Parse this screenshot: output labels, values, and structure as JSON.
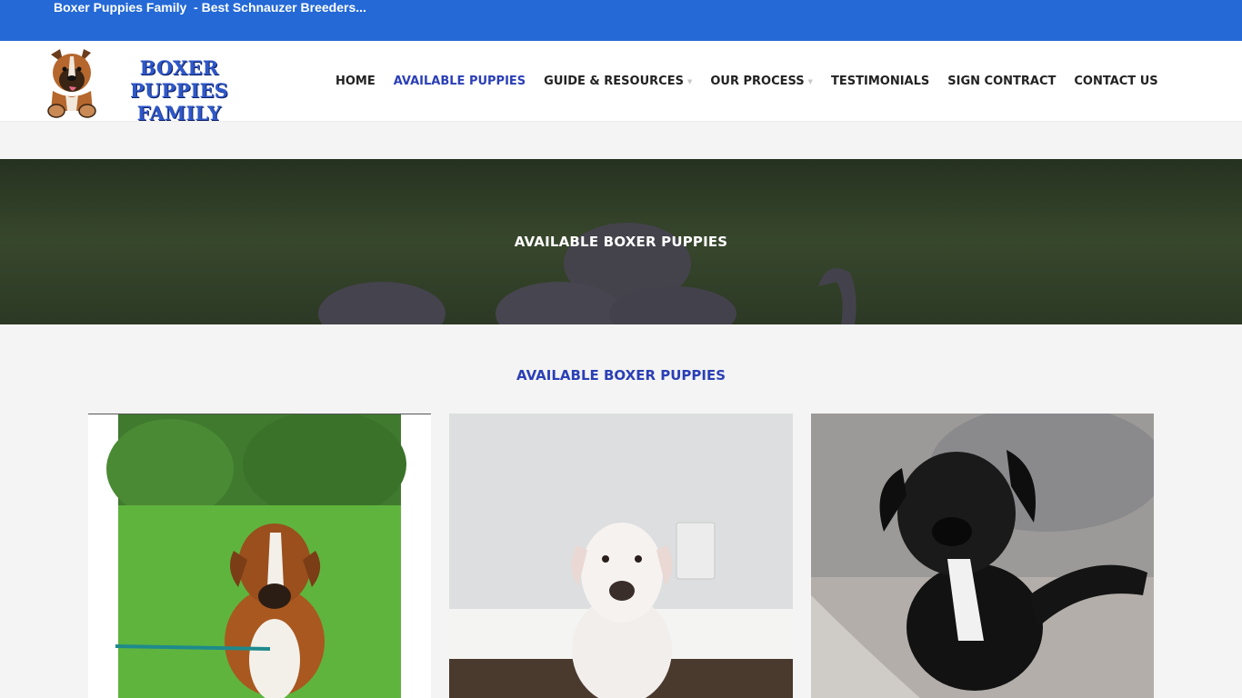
{
  "topbar": {
    "title": "Boxer Puppies Family  - Best Schnauzer Breeders..."
  },
  "logo": {
    "line1": "BOXER PUPPIES",
    "line2": "FAMILY"
  },
  "nav": {
    "items": [
      {
        "label": "HOME",
        "active": false,
        "dropdown": false
      },
      {
        "label": "AVAILABLE PUPPIES",
        "active": true,
        "dropdown": false
      },
      {
        "label": "GUIDE & RESOURCES",
        "active": false,
        "dropdown": true
      },
      {
        "label": "OUR PROCESS",
        "active": false,
        "dropdown": true
      },
      {
        "label": "TESTIMONIALS",
        "active": false,
        "dropdown": false
      },
      {
        "label": "SIGN CONTRACT",
        "active": false,
        "dropdown": false
      },
      {
        "label": "CONTACT US",
        "active": false,
        "dropdown": false
      }
    ],
    "caret_icon": "chevron-down-icon"
  },
  "hero": {
    "title": "AVAILABLE BOXER PUPPIES"
  },
  "section": {
    "title": "AVAILABLE BOXER PUPPIES"
  },
  "cards": [
    {
      "image": "fawn-white-boxer-puppy-on-grass"
    },
    {
      "image": "white-boxer-puppy-sitting"
    },
    {
      "image": "black-boxer-puppy-on-blanket"
    }
  ],
  "colors": {
    "topbar_bg": "#2469d6",
    "accent": "#2b3fb6",
    "page_bg": "#f4f4f4",
    "nav_text": "#222222"
  }
}
